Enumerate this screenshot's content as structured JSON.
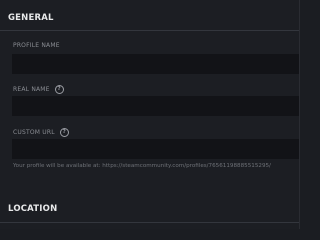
{
  "sections": {
    "general": {
      "title": "GENERAL"
    },
    "location": {
      "title": "LOCATION"
    }
  },
  "fields": {
    "profile_name": {
      "label": "PROFILE NAME",
      "value": "",
      "placeholder": ""
    },
    "real_name": {
      "label": "REAL NAME",
      "help_icon": "question-mark-circle",
      "value": "",
      "placeholder": ""
    },
    "custom_url": {
      "label": "CUSTOM URL",
      "help_icon": "question-mark-circle",
      "value": "",
      "placeholder": ""
    }
  },
  "profile_url_note": "Your profile will be available at: https://steamcommunity.com/profiles/76561198885515295/",
  "colors": {
    "background": "#1c1e23",
    "input_background": "#121317",
    "header_text": "#e8e9ea",
    "label_text": "#8a8d93",
    "note_text": "#6e7177"
  }
}
